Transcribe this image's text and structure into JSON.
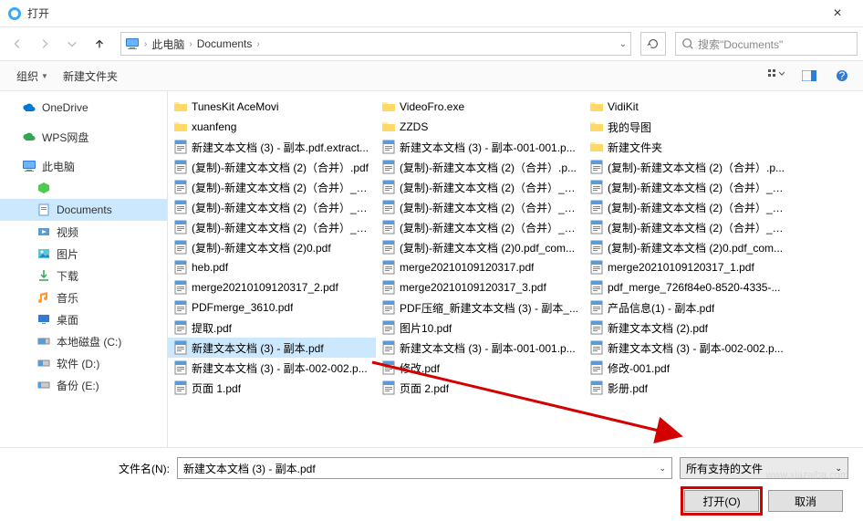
{
  "title": "打开",
  "breadcrumb": {
    "pc": "此电脑",
    "folder": "Documents"
  },
  "search_placeholder": "搜索\"Documents\"",
  "toolbar": {
    "organize": "组织",
    "newfolder": "新建文件夹"
  },
  "sidebar": {
    "onedrive": "OneDrive",
    "wps": "WPS网盘",
    "thispc": "此电脑",
    "documents": "Documents",
    "videos": "视频",
    "pictures": "图片",
    "downloads": "下载",
    "music": "音乐",
    "desktop": "桌面",
    "diskc": "本地磁盘 (C:)",
    "diskd": "软件 (D:)",
    "diske": "备份 (E:)"
  },
  "files": {
    "col1": [
      {
        "t": "folder",
        "n": "TunesKit AceMovi"
      },
      {
        "t": "folder",
        "n": "xuanfeng"
      },
      {
        "t": "pdf",
        "n": "新建文本文档 (3) - 副本.pdf.extract..."
      },
      {
        "t": "pdf",
        "n": "(复制)-新建文本文档 (2)（合并）.pdf"
      },
      {
        "t": "pdf",
        "n": "(复制)-新建文本文档 (2)（合并）_1..."
      },
      {
        "t": "pdf",
        "n": "(复制)-新建文本文档 (2)（合并）_加..."
      },
      {
        "t": "pdf",
        "n": "(复制)-新建文本文档 (2)（合并）_加..."
      },
      {
        "t": "pdf",
        "n": "(复制)-新建文本文档 (2)0.pdf"
      },
      {
        "t": "pdf",
        "n": "heb.pdf"
      },
      {
        "t": "pdf",
        "n": "merge20210109120317_2.pdf"
      },
      {
        "t": "pdf",
        "n": "PDFmerge_3610.pdf"
      },
      {
        "t": "pdf",
        "n": "提取.pdf"
      },
      {
        "t": "pdf",
        "n": "新建文本文档 (3) - 副本.pdf",
        "sel": true
      },
      {
        "t": "pdf",
        "n": "新建文本文档 (3) - 副本-002-002.p..."
      },
      {
        "t": "pdf",
        "n": "页面 1.pdf"
      }
    ],
    "col2": [
      {
        "t": "folder",
        "n": "VideoFro.exe"
      },
      {
        "t": "folder",
        "n": "ZZDS"
      },
      {
        "t": "pdf",
        "n": "新建文本文档 (3) - 副本-001-001.p..."
      },
      {
        "t": "pdf",
        "n": "(复制)-新建文本文档 (2)（合并）.p..."
      },
      {
        "t": "pdf",
        "n": "(复制)-新建文本文档 (2)（合并）_c..."
      },
      {
        "t": "pdf",
        "n": "(复制)-新建文本文档 (2)（合并）_加..."
      },
      {
        "t": "pdf",
        "n": "(复制)-新建文本文档 (2)（合并）_加..."
      },
      {
        "t": "pdf",
        "n": "(复制)-新建文本文档 (2)0.pdf_com..."
      },
      {
        "t": "pdf",
        "n": "merge20210109120317.pdf"
      },
      {
        "t": "pdf",
        "n": "merge20210109120317_3.pdf"
      },
      {
        "t": "pdf",
        "n": "PDF压缩_新建文本文档 (3) - 副本_..."
      },
      {
        "t": "pdf",
        "n": "图片10.pdf"
      },
      {
        "t": "pdf",
        "n": "新建文本文档 (3) - 副本-001-001.p..."
      },
      {
        "t": "pdf",
        "n": "修改.pdf"
      },
      {
        "t": "pdf",
        "n": "页面 2.pdf"
      }
    ],
    "col3": [
      {
        "t": "folder",
        "n": "VidiKit"
      },
      {
        "t": "folder",
        "n": "我的导图"
      },
      {
        "t": "folder",
        "n": "新建文件夹"
      },
      {
        "t": "pdf",
        "n": "(复制)-新建文本文档 (2)（合并）.p..."
      },
      {
        "t": "pdf",
        "n": "(复制)-新建文本文档 (2)（合并）_加..."
      },
      {
        "t": "pdf",
        "n": "(复制)-新建文本文档 (2)（合并）_加..."
      },
      {
        "t": "pdf",
        "n": "(复制)-新建文本文档 (2)（合并）_已..."
      },
      {
        "t": "pdf",
        "n": "(复制)-新建文本文档 (2)0.pdf_com..."
      },
      {
        "t": "pdf",
        "n": "merge20210109120317_1.pdf"
      },
      {
        "t": "pdf",
        "n": "pdf_merge_726f84e0-8520-4335-..."
      },
      {
        "t": "pdf",
        "n": "产品信息(1) - 副本.pdf"
      },
      {
        "t": "pdf",
        "n": "新建文本文档 (2).pdf"
      },
      {
        "t": "pdf",
        "n": "新建文本文档 (3) - 副本-002-002.p..."
      },
      {
        "t": "pdf",
        "n": "修改-001.pdf"
      },
      {
        "t": "pdf",
        "n": "影册.pdf"
      }
    ]
  },
  "filename_label": "文件名(N):",
  "filename_value": "新建文本文档 (3) - 副本.pdf",
  "filter": "所有支持的文件",
  "open_btn": "打开(O)",
  "cancel_btn": "取消",
  "watermark": "www.xiazaiba.com"
}
